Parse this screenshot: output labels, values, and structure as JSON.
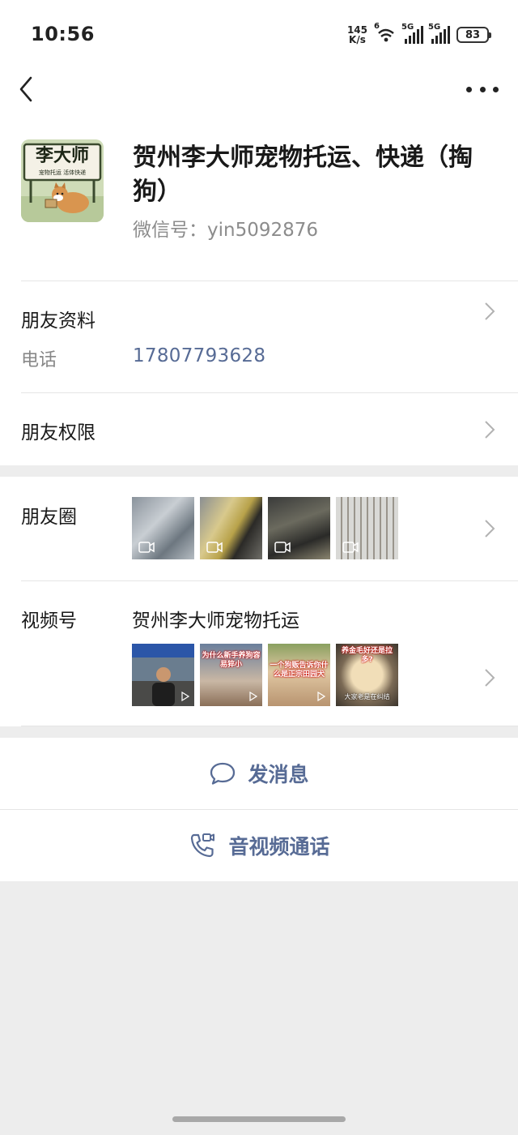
{
  "status_bar": {
    "time": "10:56",
    "net_speed_value": "145",
    "net_speed_unit": "K/s",
    "wifi_label": "6",
    "sim1_label": "5G",
    "sim2_label": "5G",
    "battery": "83"
  },
  "profile": {
    "name": "贺州李大师宠物托运、快递（掏狗）",
    "wechat_id": "微信号：yin5092876",
    "avatar_title": "李大师",
    "avatar_subtitle": "宠物托运 活体快递"
  },
  "friend_info": {
    "title": "朋友资料",
    "phone_label": "电话",
    "phone_value": "17807793628"
  },
  "friend_permission": {
    "title": "朋友权限"
  },
  "moments": {
    "title": "朋友圈",
    "thumbnails": [
      "video",
      "video",
      "video",
      "video"
    ]
  },
  "channels": {
    "title": "视频号",
    "channel_name": "贺州李大师宠物托运",
    "thumbnails": [
      {
        "caption_top": "",
        "caption_bottom": ""
      },
      {
        "caption_top": "为什么新手养狗容易猝小",
        "caption_bottom": ""
      },
      {
        "caption_top": "一个狗贩告诉你什么是正宗田园犬",
        "caption_bottom": ""
      },
      {
        "caption_top": "养金毛好还是拉多?",
        "caption_bottom": "大家老是在纠结"
      }
    ]
  },
  "actions": {
    "message_label": "发消息",
    "call_label": "音视频通话"
  },
  "colors": {
    "link": "#576b95",
    "background": "#ededed",
    "card": "#ffffff"
  }
}
